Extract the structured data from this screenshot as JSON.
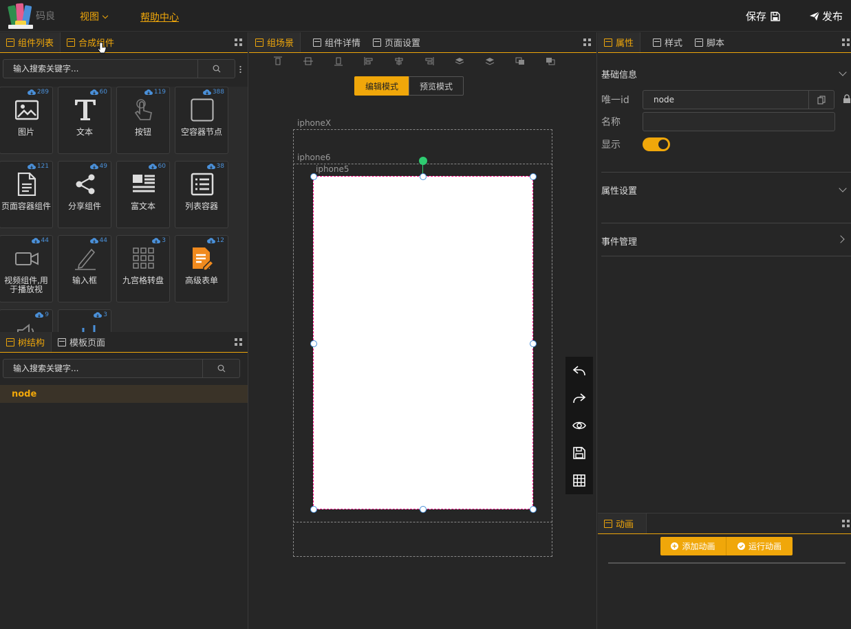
{
  "topbar": {
    "brand": "码良",
    "view_menu": "视图",
    "help": "帮助中心",
    "save": "保存",
    "publish": "发布"
  },
  "left_panel": {
    "tabs": [
      {
        "label": "组件列表",
        "active": true
      },
      {
        "label": "合成组件",
        "active": false
      }
    ],
    "search_placeholder": "输入搜索关键字...",
    "components": [
      {
        "label": "图片",
        "count": "289",
        "icon": "image-icon"
      },
      {
        "label": "文本",
        "count": "60",
        "icon": "text-icon"
      },
      {
        "label": "按钮",
        "count": "119",
        "icon": "tap-icon"
      },
      {
        "label": "空容器节点",
        "count": "388",
        "icon": "square-icon"
      },
      {
        "label": "页面容器组件",
        "count": "121",
        "icon": "document-icon"
      },
      {
        "label": "分享组件",
        "count": "49",
        "icon": "share-icon"
      },
      {
        "label": "富文本",
        "count": "60",
        "icon": "richtext-icon"
      },
      {
        "label": "列表容器",
        "count": "38",
        "icon": "list-icon"
      },
      {
        "label": "视频组件,用于播放视",
        "count": "44",
        "icon": "video-icon"
      },
      {
        "label": "输入框",
        "count": "44",
        "icon": "pen-icon"
      },
      {
        "label": "九宫格转盘",
        "count": "3",
        "icon": "grid9-icon"
      },
      {
        "label": "高级表单",
        "count": "12",
        "icon": "form-icon"
      },
      {
        "label": "",
        "count": "9",
        "icon": "speaker-icon"
      },
      {
        "label": "",
        "count": "3",
        "icon": "chart-icon"
      }
    ]
  },
  "tree_panel": {
    "tabs": [
      {
        "label": "树结构",
        "active": true
      },
      {
        "label": "模板页面",
        "active": false
      }
    ],
    "search_placeholder": "输入搜索关键字...",
    "nodes": [
      "node"
    ]
  },
  "center_panel": {
    "tabs": [
      {
        "label": "组场景",
        "active": true
      },
      {
        "label": "组件详情",
        "active": false
      },
      {
        "label": "页面设置",
        "active": false
      }
    ],
    "mode_edit": "编辑模式",
    "mode_preview": "预览模式",
    "frames": [
      "iphoneX",
      "iphone6",
      "iphone5"
    ]
  },
  "right_panel": {
    "tabs": [
      {
        "label": "属性",
        "active": true
      },
      {
        "label": "样式",
        "active": false
      },
      {
        "label": "脚本",
        "active": false
      }
    ],
    "basic_info": "基础信息",
    "id_label": "唯一id",
    "id_value": "node",
    "name_label": "名称",
    "name_value": "",
    "show_label": "显示",
    "show_on": true,
    "attr_settings": "属性设置",
    "event_mgmt": "事件管理"
  },
  "anim_panel": {
    "tab": "动画",
    "add": "添加动画",
    "run": "运行动画"
  },
  "colors": {
    "accent": "#f0a70a",
    "bg": "#262626",
    "badge": "#4a90d9"
  }
}
